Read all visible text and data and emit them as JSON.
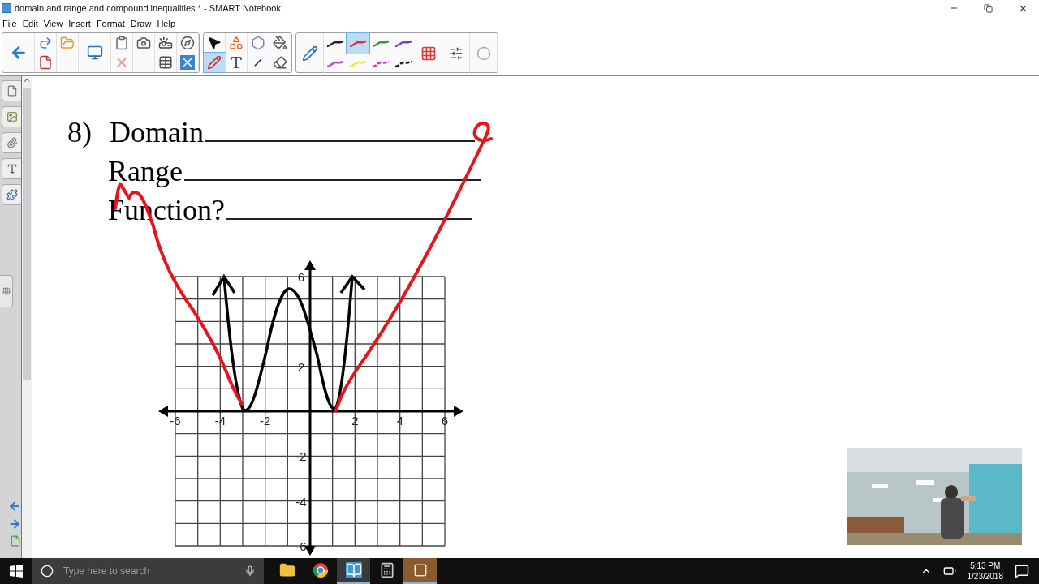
{
  "window": {
    "title": "domain and range and compound inequalities * - SMART Notebook"
  },
  "menu": [
    "File",
    "Edit",
    "View",
    "Insert",
    "Format",
    "Draw",
    "Help"
  ],
  "toolbar": {
    "groups": [
      {
        "columns": [
          [
            {
              "kind": "back"
            }
          ],
          [
            {
              "kind": "redo"
            },
            {
              "kind": "delete-page"
            }
          ],
          [
            {
              "kind": "open"
            },
            {
              "kind": "blank"
            }
          ],
          [
            {
              "kind": "screen"
            }
          ],
          [
            {
              "kind": "paste"
            },
            {
              "kind": "delete"
            }
          ],
          [
            {
              "kind": "camera"
            },
            {
              "kind": "blank"
            }
          ],
          [
            {
              "kind": "doc-camera"
            },
            {
              "kind": "table"
            }
          ],
          [
            {
              "kind": "measure"
            },
            {
              "kind": "close-box"
            }
          ]
        ]
      },
      {
        "columns": [
          [
            {
              "kind": "select",
              "selected": false
            },
            {
              "kind": "pens",
              "selected": true
            }
          ],
          [
            {
              "kind": "shapes",
              "selected": false
            },
            {
              "kind": "text",
              "selected": false
            }
          ],
          [
            {
              "kind": "polygon",
              "selected": false
            },
            {
              "kind": "line",
              "selected": false
            }
          ],
          [
            {
              "kind": "fill",
              "selected": false
            },
            {
              "kind": "eraser",
              "selected": false
            }
          ]
        ]
      }
    ],
    "pen_styles": [
      {
        "color": "#222222",
        "selected": false
      },
      {
        "color": "#e0302e",
        "selected": true
      },
      {
        "color": "#2aa02a",
        "selected": false
      },
      {
        "color": "#6a3fc8",
        "selected": false
      },
      {
        "color": "#b04fb8",
        "selected": false
      },
      {
        "color": "#e8e84a",
        "selected": false
      },
      {
        "color": "#d62ad6",
        "selected": false
      },
      {
        "color": "#111111",
        "selected": false
      }
    ]
  },
  "side_tabs": [
    {
      "kind": "pages"
    },
    {
      "kind": "gallery"
    },
    {
      "kind": "attachments"
    },
    {
      "kind": "properties"
    },
    {
      "kind": "addons"
    }
  ],
  "worksheet": {
    "number": "8)",
    "lines": [
      "Domain",
      "Range",
      "Function?"
    ],
    "graph": {
      "x_labels": [
        "-6",
        "-4",
        "-2",
        "2",
        "4",
        "6"
      ],
      "y_labels": [
        "6",
        "2",
        "-2",
        "-4",
        "-6"
      ]
    }
  },
  "webcam": {
    "kind": "picture"
  },
  "taskbar": {
    "search": {
      "placeholder": "Type here to search"
    },
    "apps": [
      {
        "kind": "folder",
        "selected": false
      },
      {
        "kind": "chrome",
        "selected": false
      },
      {
        "kind": "notebook",
        "selected": true
      },
      {
        "kind": "calculator",
        "selected": false
      },
      {
        "kind": "snip",
        "selected": true
      }
    ],
    "time": "5:13 PM",
    "date": "1/23/2018"
  }
}
